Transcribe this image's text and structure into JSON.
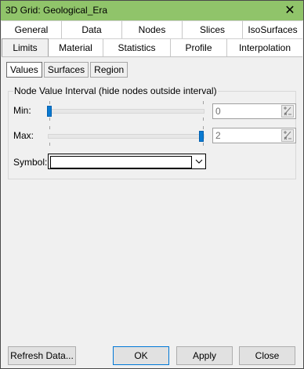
{
  "window": {
    "title": "3D Grid: Geological_Era",
    "close_glyph": "✕"
  },
  "tabs_row1": [
    "General",
    "Data",
    "Nodes",
    "Slices",
    "IsoSurfaces"
  ],
  "tabs_row2": [
    "Limits",
    "Material",
    "Statistics",
    "Profile",
    "Interpolation"
  ],
  "active_tab": "Limits",
  "subtabs": [
    "Values",
    "Surfaces",
    "Region"
  ],
  "active_subtab": "Values",
  "group": {
    "title": "Node Value Interval (hide nodes outside interval)",
    "min_label": "Min:",
    "min_value": "0",
    "max_label": "Max:",
    "max_value": "2",
    "symbol_label": "Symbol:",
    "symbol_value": ""
  },
  "buttons": {
    "refresh": "Refresh Data...",
    "ok": "OK",
    "apply": "Apply",
    "close": "Close"
  },
  "colors": {
    "titlebar": "#90c46a",
    "slider_thumb": "#0a7ad1"
  },
  "icons": {
    "spin_icon": "calculator-spin-icon",
    "caret": "chevron-down-icon"
  }
}
